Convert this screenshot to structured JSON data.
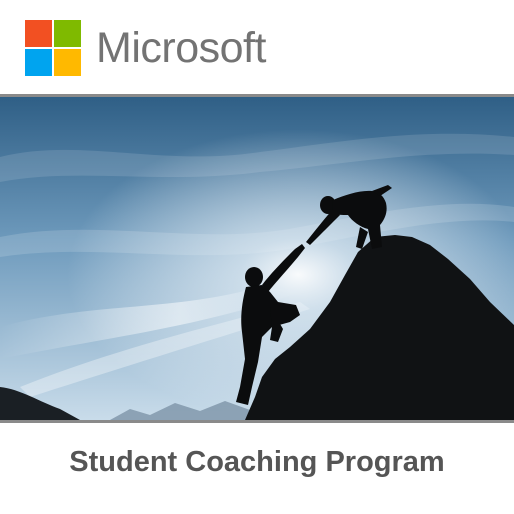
{
  "brand": {
    "name": "Microsoft",
    "logo_colors": {
      "top_left": "#F25022",
      "top_right": "#7FBA00",
      "bottom_left": "#00A4EF",
      "bottom_right": "#FFB900"
    },
    "wordmark_color": "#737373"
  },
  "hero": {
    "image": "silhouette-helping-hand-climbing-icon",
    "sky_colors": [
      "#2f5f86",
      "#7aa3c2",
      "#dfeaf2"
    ]
  },
  "caption": {
    "text": "Student Coaching Program",
    "color": "#555555"
  }
}
